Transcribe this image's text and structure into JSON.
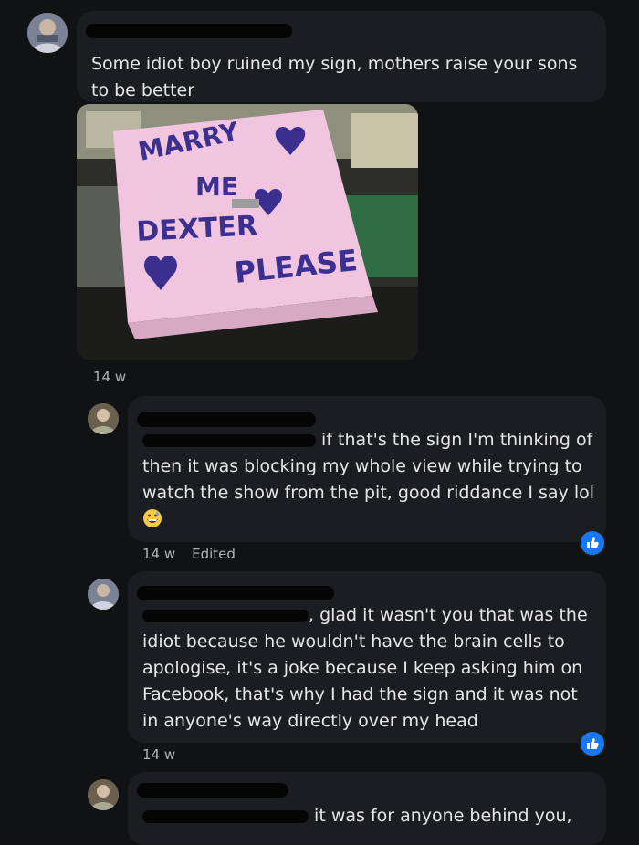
{
  "post": {
    "text": "Some idiot boy ruined my sign, mothers raise your sons to be better",
    "time": "14 w",
    "photo": {
      "lines": [
        "MARRY",
        "ME",
        "DEXTER",
        "PLEASE"
      ]
    }
  },
  "comments": [
    {
      "text": "if that's the sign I'm thinking of then it was blocking my whole view while trying to watch the show from the pit, good riddance I say lol",
      "emoji": "grinning-sweat-face",
      "time": "14 w",
      "edited": "Edited",
      "reaction": "like"
    },
    {
      "text": ", glad it wasn't you that was the idiot because he wouldn't have the brain cells to apologise, it's a joke because I keep asking him on Facebook, that's why I had the sign and it was not in anyone's way directly over my head",
      "time": "14 w",
      "reaction": "like"
    },
    {
      "text": "it was for anyone behind you,"
    }
  ],
  "colors": {
    "background": "#111214",
    "bubble": "#1c1d20",
    "like": "#1877f2",
    "sign": "#f1c5df",
    "ink": "#3b2f8f"
  }
}
